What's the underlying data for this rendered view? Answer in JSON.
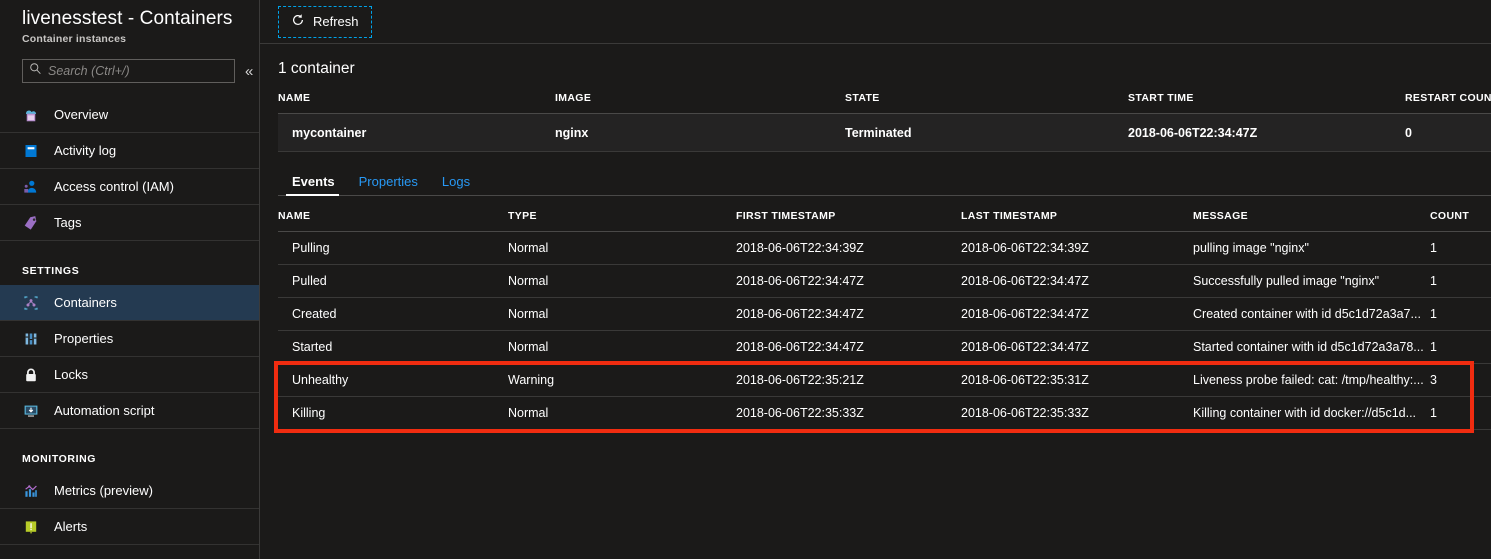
{
  "blade": {
    "title": "livenesstest - Containers",
    "subtitle": "Container instances",
    "search_placeholder": "Search (Ctrl+/)",
    "search_value": "",
    "collapse_label": "«"
  },
  "sidebar": {
    "items": [
      {
        "label": "Overview",
        "icon": "overview-cloud-icon",
        "selected": false
      },
      {
        "label": "Activity log",
        "icon": "activity-log-icon",
        "selected": false
      },
      {
        "label": "Access control (IAM)",
        "icon": "access-control-icon",
        "selected": false
      },
      {
        "label": "Tags",
        "icon": "tag-icon",
        "selected": false
      }
    ],
    "settings_header": "SETTINGS",
    "settings_items": [
      {
        "label": "Containers",
        "icon": "containers-icon",
        "selected": true
      },
      {
        "label": "Properties",
        "icon": "properties-icon",
        "selected": false
      },
      {
        "label": "Locks",
        "icon": "lock-icon",
        "selected": false
      },
      {
        "label": "Automation script",
        "icon": "automation-script-icon",
        "selected": false
      }
    ],
    "monitoring_header": "MONITORING",
    "monitoring_items": [
      {
        "label": "Metrics (preview)",
        "icon": "metrics-chart-icon",
        "selected": false
      },
      {
        "label": "Alerts",
        "icon": "alerts-warning-icon",
        "selected": false
      }
    ]
  },
  "toolbar": {
    "refresh_label": "Refresh",
    "refresh_icon": "refresh-icon",
    "refresh_focused": true
  },
  "containers_panel": {
    "count_label": "1 container",
    "columns": [
      "NAME",
      "IMAGE",
      "STATE",
      "START TIME",
      "RESTART COUNT"
    ],
    "rows": [
      {
        "name": "mycontainer",
        "image": "nginx",
        "state": "Terminated",
        "start_time": "2018-06-06T22:34:47Z",
        "restart_count": "0"
      }
    ]
  },
  "tabs": [
    {
      "label": "Events",
      "active": true
    },
    {
      "label": "Properties",
      "active": false
    },
    {
      "label": "Logs",
      "active": false
    }
  ],
  "events_panel": {
    "columns": [
      "NAME",
      "TYPE",
      "FIRST TIMESTAMP",
      "LAST TIMESTAMP",
      "MESSAGE",
      "COUNT"
    ],
    "rows": [
      {
        "name": "Pulling",
        "type": "Normal",
        "first_timestamp": "2018-06-06T22:34:39Z",
        "last_timestamp": "2018-06-06T22:34:39Z",
        "message": "pulling image \"nginx\"",
        "count": "1",
        "highlighted": false
      },
      {
        "name": "Pulled",
        "type": "Normal",
        "first_timestamp": "2018-06-06T22:34:47Z",
        "last_timestamp": "2018-06-06T22:34:47Z",
        "message": "Successfully pulled image \"nginx\"",
        "count": "1",
        "highlighted": false
      },
      {
        "name": "Created",
        "type": "Normal",
        "first_timestamp": "2018-06-06T22:34:47Z",
        "last_timestamp": "2018-06-06T22:34:47Z",
        "message": "Created container with id d5c1d72a3a7...",
        "count": "1",
        "highlighted": false
      },
      {
        "name": "Started",
        "type": "Normal",
        "first_timestamp": "2018-06-06T22:34:47Z",
        "last_timestamp": "2018-06-06T22:34:47Z",
        "message": "Started container with id d5c1d72a3a78...",
        "count": "1",
        "highlighted": false
      },
      {
        "name": "Unhealthy",
        "type": "Warning",
        "first_timestamp": "2018-06-06T22:35:21Z",
        "last_timestamp": "2018-06-06T22:35:31Z",
        "message": "Liveness probe failed: cat: /tmp/healthy:...",
        "count": "3",
        "highlighted": true
      },
      {
        "name": "Killing",
        "type": "Normal",
        "first_timestamp": "2018-06-06T22:35:33Z",
        "last_timestamp": "2018-06-06T22:35:33Z",
        "message": "Killing container with id docker://d5c1d...",
        "count": "1",
        "highlighted": true
      }
    ]
  },
  "colors": {
    "background": "#1b1a19",
    "selected_nav": "#243a51",
    "link_blue": "#2899f5",
    "focus_outline": "#00a2e8",
    "highlight_red": "#f02c10"
  }
}
